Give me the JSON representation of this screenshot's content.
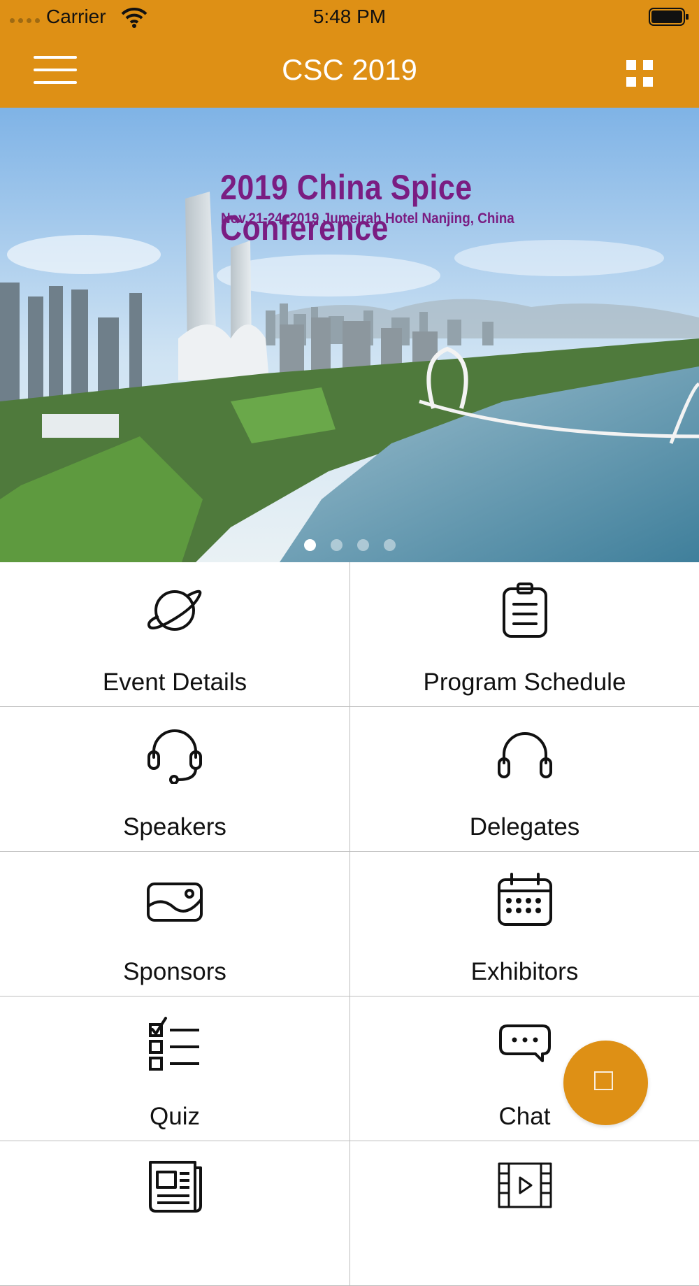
{
  "status_bar": {
    "carrier": "Carrier",
    "time": "5:48 PM"
  },
  "navbar": {
    "title": "CSC 2019",
    "accent_color": "#DE9015"
  },
  "banner": {
    "title": "2019 China Spice Conference",
    "subtitle": "Nov.21-24, 2019  Jumeirah Hotel Nanjing, China",
    "title_color": "#7a1d82",
    "slide_count": 4,
    "active_slide": 1
  },
  "menu": [
    {
      "label": "Event Details",
      "icon": "planet-icon"
    },
    {
      "label": "Program Schedule",
      "icon": "clipboard-icon"
    },
    {
      "label": "Speakers",
      "icon": "headset-mic-icon"
    },
    {
      "label": "Delegates",
      "icon": "headphones-icon"
    },
    {
      "label": "Sponsors",
      "icon": "landscape-photo-icon"
    },
    {
      "label": "Exhibitors",
      "icon": "calendar-icon"
    },
    {
      "label": "Quiz",
      "icon": "checklist-icon"
    },
    {
      "label": "Chat",
      "icon": "chat-bubble-icon"
    },
    {
      "label": "",
      "icon": "newspaper-icon"
    },
    {
      "label": "",
      "icon": "film-play-icon"
    }
  ],
  "fab": {
    "icon": "square-icon"
  }
}
